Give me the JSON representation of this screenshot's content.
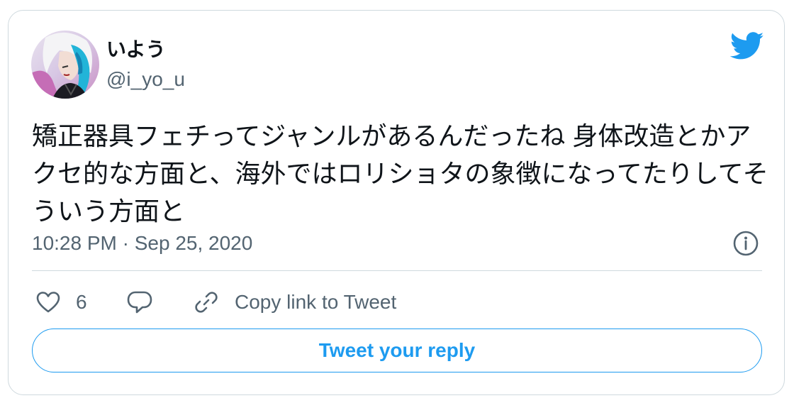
{
  "author": {
    "display_name": "いよう",
    "handle": "@i_yo_u",
    "avatar_icon": "user-avatar"
  },
  "brand": {
    "icon": "twitter-bird-icon",
    "color": "#1d9bf0"
  },
  "tweet": {
    "text": "矯正器具フェチってジャンルがあるんだったね 身体改造とかアクセ的な方面と、海外ではロリショタの象徴になってたりしてそういう方面と",
    "timestamp": "10:28 PM · Sep 25, 2020"
  },
  "actions": {
    "like_count": "6",
    "copy_link_label": "Copy link to Tweet"
  },
  "reply": {
    "button_label": "Tweet your reply"
  },
  "colors": {
    "text_primary": "#0f1419",
    "text_secondary": "#536471",
    "border": "#cfd9de",
    "accent": "#1d9bf0"
  }
}
